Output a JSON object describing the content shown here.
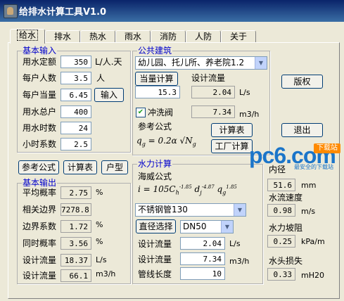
{
  "window": {
    "title": "给排水计算工具V1.0"
  },
  "tabs": [
    "给水",
    "排水",
    "热水",
    "雨水",
    "消防",
    "人防",
    "关于"
  ],
  "basic_input": {
    "title": "基本输入",
    "rows": [
      {
        "label": "用水定额",
        "value": "350",
        "unit": "L/人.天"
      },
      {
        "label": "每户人数",
        "value": "3.5",
        "unit": "人"
      },
      {
        "label": "每户当量",
        "value": "6.45"
      },
      {
        "label": "用水总户",
        "value": "400"
      },
      {
        "label": "用水时数",
        "value": "24"
      },
      {
        "label": "小时系数",
        "value": "2.5"
      }
    ],
    "input_button": "输入"
  },
  "public_building": {
    "title": "公共建筑",
    "building_type": "幼儿园、托儿所、养老院1.2",
    "equiv_calc_button": "当量计算",
    "design_flow_label": "设计流量",
    "equiv_value": "15.3",
    "design_flow_value": "2.04",
    "design_flow_unit": "L/s",
    "flush_valve_label": "冲洗阀",
    "flush_valve_checked": true,
    "flush_value": "7.34",
    "flush_unit": "m3/h",
    "ref_formula_label": "参考公式",
    "formula": "q_g = 0.2α√N_g",
    "calc_table_button": "计算表",
    "factory_calc_button": "工厂计算"
  },
  "right_buttons": {
    "copyright": "版权",
    "exit": "退出"
  },
  "mid_buttons": [
    "参考公式",
    "计算表",
    "户型"
  ],
  "basic_output": {
    "title": "基本输出",
    "rows": [
      {
        "label": "平均概率",
        "value": "2.75",
        "unit": "%"
      },
      {
        "label": "相关边界",
        "value": "7278.8"
      },
      {
        "label": "边界系数",
        "value": "1.72",
        "unit": "%"
      },
      {
        "label": "同时概率",
        "value": "3.56",
        "unit": "%"
      },
      {
        "label": "设计流量",
        "value": "18.37",
        "unit": "L/s"
      },
      {
        "label": "设计流量",
        "value": "66.1",
        "unit": "m3/h"
      }
    ]
  },
  "hydraulic": {
    "title": "水力计算",
    "hazen_label": "海威公式",
    "formula": "i = 105C_h^-1.85 d_j^-4.87 q_g^1.85",
    "pipe_material": "不锈钢管130",
    "diameter_button": "直径选择",
    "diameter": "DN50",
    "rows": [
      {
        "label": "设计流量",
        "value": "2.04",
        "unit": "L/s"
      },
      {
        "label": "设计流量",
        "value": "7.34",
        "unit": "m3/h"
      },
      {
        "label": "管线长度",
        "value": "10"
      }
    ]
  },
  "results": {
    "inner_dia_label": "内径",
    "inner_dia_value": "51.6",
    "inner_dia_unit": "mm",
    "velocity_label": "水流速度",
    "velocity_value": "0.98",
    "velocity_unit": "m/s",
    "friction_label": "水力坡阻",
    "friction_value": "0.25",
    "friction_unit": "kPa/m",
    "headloss_label": "水头损失",
    "headloss_value": "0.33",
    "headloss_unit": "mH20"
  },
  "watermark": {
    "brand": "pc6.com",
    "badge": "下载站",
    "slogan": "最安全的下载站"
  },
  "colors": {
    "group_title": "#0000cc",
    "titlebar": "#0a246a",
    "brand_blue": "#1b75c9",
    "brand_orange": "#ff8a00"
  }
}
